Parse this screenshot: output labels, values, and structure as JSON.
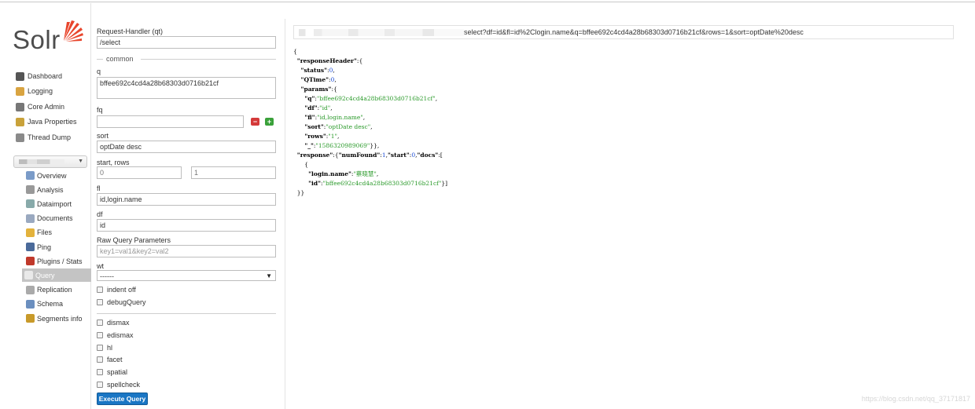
{
  "app": {
    "logo_text": "Solr"
  },
  "sidebar": {
    "items": [
      {
        "label": "Dashboard",
        "icon": "dashboard-icon"
      },
      {
        "label": "Logging",
        "icon": "logging-icon"
      },
      {
        "label": "Core Admin",
        "icon": "core-admin-icon"
      },
      {
        "label": "Java Properties",
        "icon": "java-properties-icon"
      },
      {
        "label": "Thread Dump",
        "icon": "thread-dump-icon"
      }
    ],
    "core_sub_items": [
      {
        "label": "Overview",
        "icon": "overview-icon"
      },
      {
        "label": "Analysis",
        "icon": "analysis-icon"
      },
      {
        "label": "Dataimport",
        "icon": "dataimport-icon"
      },
      {
        "label": "Documents",
        "icon": "documents-icon"
      },
      {
        "label": "Files",
        "icon": "files-icon"
      },
      {
        "label": "Ping",
        "icon": "ping-icon"
      },
      {
        "label": "Plugins / Stats",
        "icon": "plugins-icon"
      },
      {
        "label": "Query",
        "icon": "query-icon",
        "active": true
      },
      {
        "label": "Replication",
        "icon": "replication-icon"
      },
      {
        "label": "Schema",
        "icon": "schema-icon"
      },
      {
        "label": "Segments info",
        "icon": "segments-icon"
      }
    ]
  },
  "form": {
    "request_handler_label": "Request-Handler (qt)",
    "request_handler_value": "/select",
    "common_legend": "common",
    "q_label": "q",
    "q_value": "bffee692c4cd4a28b68303d0716b21cf",
    "fq_label": "fq",
    "fq_value": "",
    "fq_remove": "−",
    "fq_add": "+",
    "sort_label": "sort",
    "sort_value": "optDate desc",
    "start_rows_label": "start, rows",
    "start_value": "0",
    "rows_value": "1",
    "fl_label": "fl",
    "fl_value": "id,login.name",
    "df_label": "df",
    "df_value": "id",
    "raw_label": "Raw Query Parameters",
    "raw_placeholder": "key1=val1&key2=val2",
    "wt_label": "wt",
    "wt_value": "------",
    "checkboxes_top": [
      "indent off",
      "debugQuery"
    ],
    "checkboxes_bottom": [
      "dismax",
      "edismax",
      "hl",
      "facet",
      "spatial",
      "spellcheck"
    ],
    "execute_label": "Execute Query"
  },
  "result": {
    "url_text": "select?df=id&fl=id%2Clogin.name&q=bffee692c4cd4a28b68303d0716b21cf&rows=1&sort=optDate%20desc",
    "json_lines": [
      "{",
      "  \"responseHeader\":{",
      "    \"status\":0,",
      "    \"QTime\":0,",
      "    \"params\":{",
      "      \"q\":\"bffee692c4cd4a28b68303d0716b21cf\",",
      "      \"df\":\"id\",",
      "      \"fl\":\"id,login.name\",",
      "      \"sort\":\"optDate desc\",",
      "      \"rows\":\"1\",",
      "      \"_\":\"1586320989069\"}},",
      "  \"response\":{\"numFound\":1,\"start\":0,\"docs\":[",
      "      {",
      "        \"login.name\":\"蔡晓慧\",",
      "        \"id\":\"bffee692c4cd4a28b68303d0716b21cf\"}]",
      "  }}"
    ],
    "watermark": "https://blog.csdn.net/qq_37171817"
  },
  "colors": {
    "accent": "#1a76c4",
    "logo_orange": "#e8452c",
    "json_string": "#2a9a2a",
    "json_number": "#1a4bd4",
    "active_item_bg": "#c4c4c4"
  }
}
